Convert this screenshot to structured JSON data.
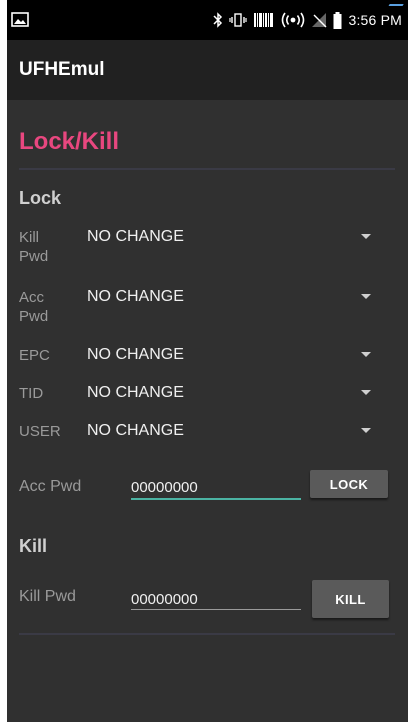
{
  "status_bar": {
    "time": "3:56 PM",
    "icons": [
      "image-icon",
      "bluetooth-icon",
      "vibrate-icon",
      "barcode-icon",
      "hotspot-icon",
      "no-signal-icon",
      "battery-icon"
    ]
  },
  "app_bar": {
    "title": "UFHEmul"
  },
  "main": {
    "section_title": "Lock/Kill",
    "lock": {
      "header": "Lock",
      "rows": [
        {
          "label": "Kill\nPwd",
          "value": "NO CHANGE"
        },
        {
          "label": "Acc\nPwd",
          "value": "NO CHANGE"
        },
        {
          "label": "EPC",
          "value": "NO CHANGE"
        },
        {
          "label": "TID",
          "value": "NO CHANGE"
        },
        {
          "label": "USER",
          "value": "NO CHANGE"
        }
      ],
      "acc_pwd_label": "Acc Pwd",
      "acc_pwd_value": "00000000",
      "button": "LOCK"
    },
    "kill": {
      "header": "Kill",
      "kill_pwd_label": "Kill Pwd",
      "kill_pwd_value": "00000000",
      "button": "KILL"
    }
  },
  "colors": {
    "accent": "#e8477f",
    "input_focus": "#4bb3a3",
    "background": "#303030",
    "app_bar": "#212121"
  }
}
